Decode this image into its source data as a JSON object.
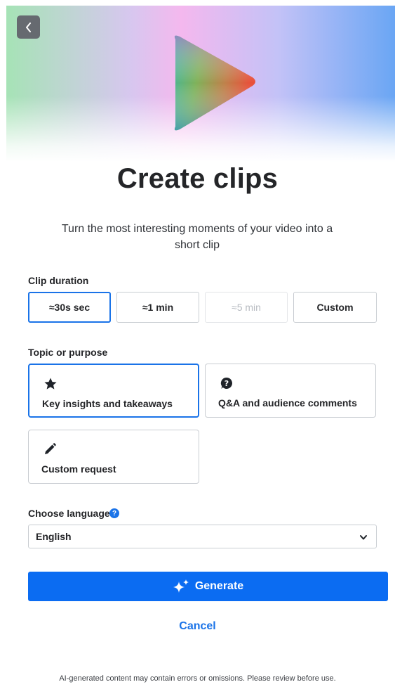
{
  "header": {
    "back_icon": "chevron-left-icon",
    "logo_icon": "play-gradient-icon",
    "title": "Create clips",
    "subtitle": "Turn the most interesting moments of your video into a short clip"
  },
  "duration": {
    "label": "Clip duration",
    "options": [
      {
        "label": "≈30s sec",
        "state": "selected"
      },
      {
        "label": "≈1 min",
        "state": "normal"
      },
      {
        "label": "≈5 min",
        "state": "disabled"
      },
      {
        "label": "Custom",
        "state": "normal"
      }
    ]
  },
  "topic": {
    "label": "Topic or purpose",
    "options": [
      {
        "label": "Key insights and takeaways",
        "icon": "star-icon",
        "state": "selected"
      },
      {
        "label": "Q&A and audience comments",
        "icon": "question-bubble-icon",
        "state": "normal"
      },
      {
        "label": "Custom request",
        "icon": "pencil-icon",
        "state": "normal"
      }
    ]
  },
  "language": {
    "label": "Choose language",
    "help_icon": "help-icon",
    "selected": "English"
  },
  "actions": {
    "generate_label": "Generate",
    "generate_icon": "sparkle-icon",
    "cancel_label": "Cancel"
  },
  "footer": {
    "disclaimer": "AI-generated content may contain errors or omissions. Please review before use."
  },
  "colors": {
    "accent": "#1a73e8",
    "primary_button": "#0b6cf2"
  }
}
